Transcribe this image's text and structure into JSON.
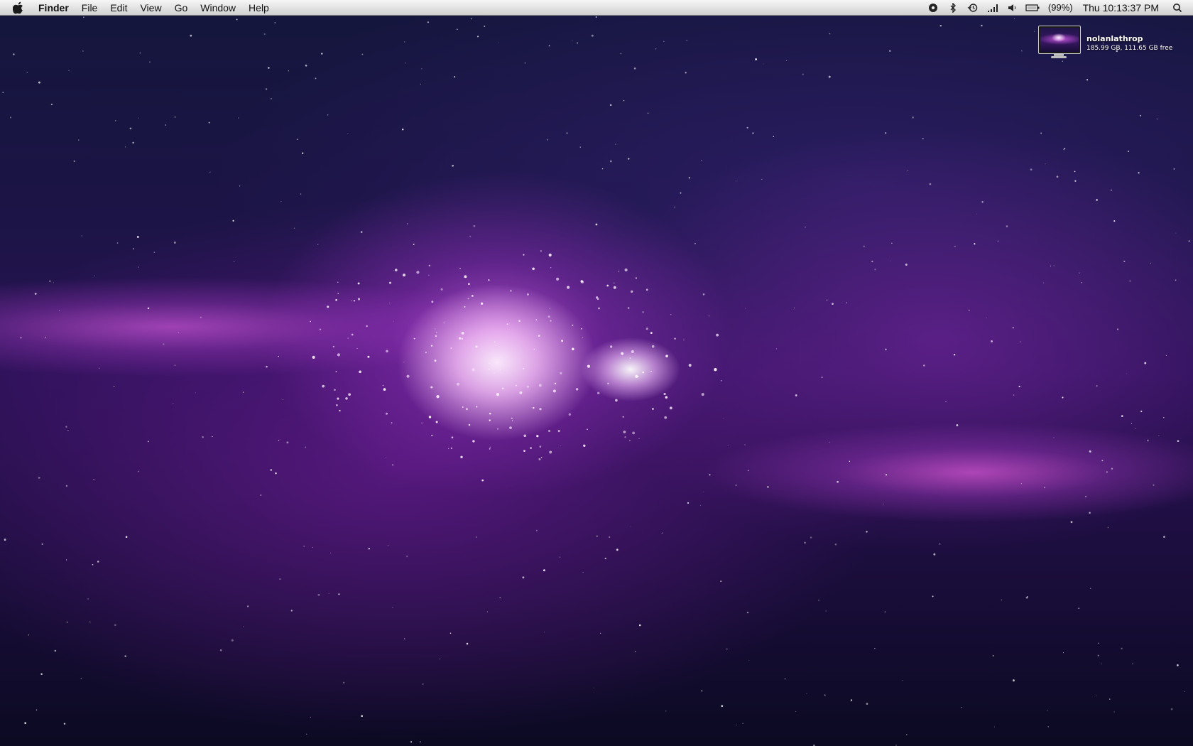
{
  "menubar": {
    "apple_icon": "apple-logo-icon",
    "app_name": "Finder",
    "menus": [
      "File",
      "Edit",
      "View",
      "Go",
      "Window",
      "Help"
    ],
    "status": {
      "icons": [
        "record-icon",
        "bluetooth-icon",
        "time-machine-icon",
        "wifi-icon",
        "volume-icon",
        "battery-icon"
      ],
      "battery_percent": "(99%)",
      "clock": "Thu 10:13:37 PM",
      "spotlight_icon": "spotlight-search-icon"
    }
  },
  "disk_widget": {
    "icon": "display-thumbnail-icon",
    "name": "nolanlathrop",
    "space": "185.99 GB, 111.65 GB free"
  },
  "colors": {
    "menubar_top": "#f6f6f6",
    "menubar_bottom": "#d0d0d0",
    "wallpaper_deep": "#14163d",
    "wallpaper_glow": "#d75ae1"
  }
}
